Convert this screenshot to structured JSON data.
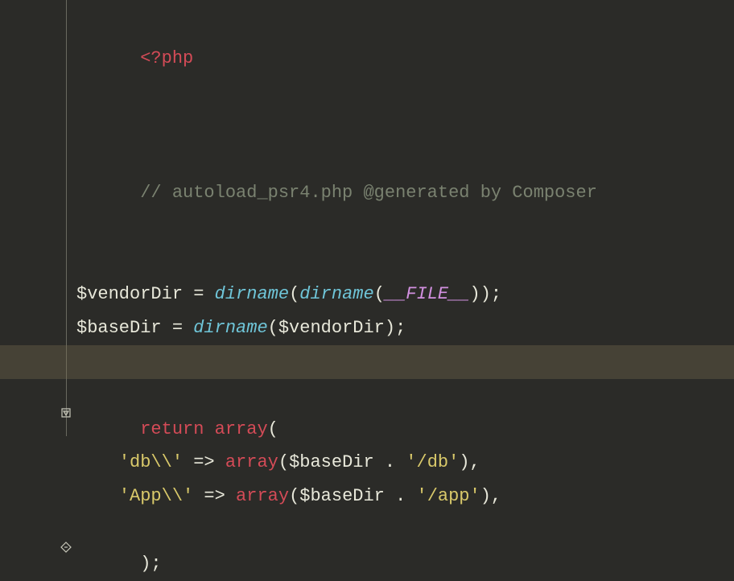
{
  "code": {
    "line1": {
      "php_open": "<?php"
    },
    "line2": {
      "comment": "// autoload_psr4.php @generated by Composer"
    },
    "line3": {
      "var1": "$vendorDir",
      "eq": " = ",
      "fn1": "dirname",
      "p1": "(",
      "fn2": "dirname",
      "p2": "(",
      "magic": "__FILE__",
      "p3": "));"
    },
    "line4": {
      "var1": "$baseDir",
      "eq": " = ",
      "fn1": "dirname",
      "p1": "(",
      "var2": "$vendorDir",
      "p2": ");"
    },
    "line5": {
      "ret": "return",
      "sp": " ",
      "arr": "array",
      "p1": "("
    },
    "line6": {
      "indent": "    ",
      "str1": "'db\\\\'",
      "arrow": " => ",
      "arr": "array",
      "p1": "(",
      "var1": "$baseDir",
      "concat": " . ",
      "str2": "'/db'",
      "p2": "),"
    },
    "line7": {
      "indent": "    ",
      "str1": "'App\\\\'",
      "arrow": " => ",
      "arr": "array",
      "p1": "(",
      "var1": "$baseDir",
      "concat": " . ",
      "str2": "'/app'",
      "p2": "),"
    },
    "line8": {
      "close": ");"
    }
  }
}
